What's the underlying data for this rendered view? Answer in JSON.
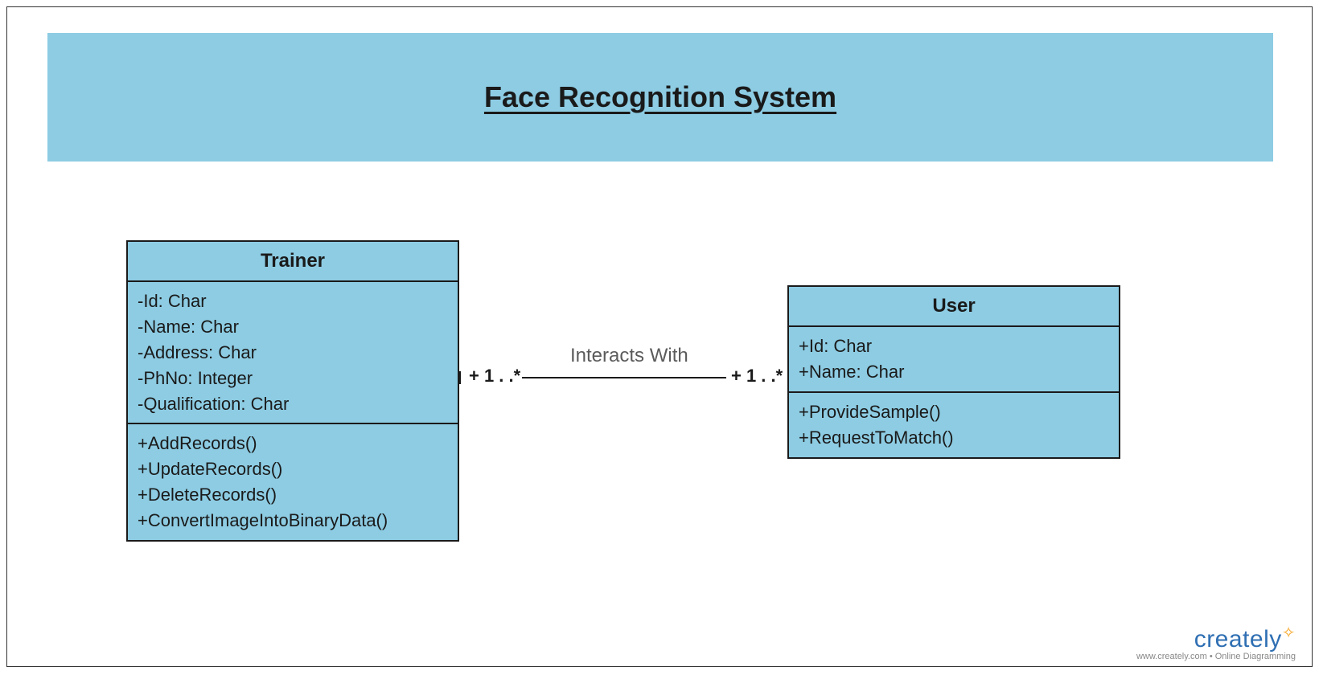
{
  "title": "Face Recognition System",
  "trainer": {
    "name": "Trainer",
    "attributes": [
      "-Id: Char",
      "-Name: Char",
      "-Address: Char",
      "-PhNo: Integer",
      "-Qualification: Char"
    ],
    "methods": [
      "+AddRecords()",
      "+UpdateRecords()",
      "+DeleteRecords()",
      "+ConvertImageIntoBinaryData()"
    ]
  },
  "user": {
    "name": "User",
    "attributes": [
      "+Id: Char",
      "+Name: Char"
    ],
    "methods": [
      "+ProvideSample()",
      "+RequestToMatch()"
    ]
  },
  "association": {
    "label": "Interacts With",
    "left_multiplicity": "+ 1 . .*",
    "right_multiplicity": "+ 1 . .*"
  },
  "watermark": {
    "brand": "creately",
    "sub": "www.creately.com • Online Diagramming"
  }
}
